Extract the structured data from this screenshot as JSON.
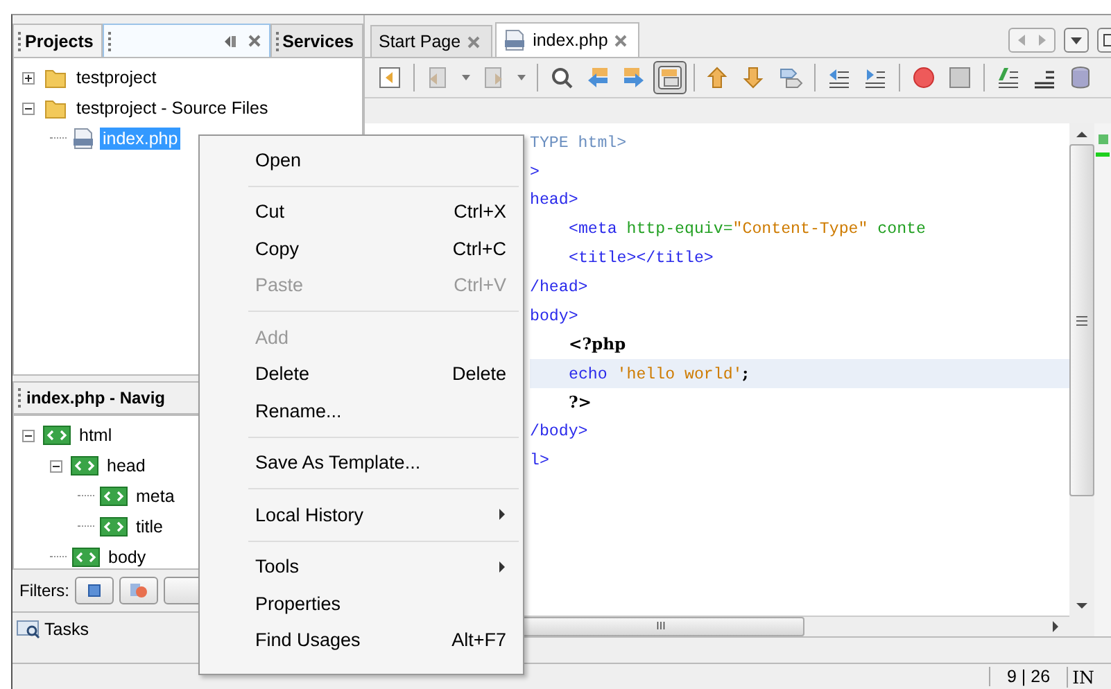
{
  "left_tabs": [
    {
      "label": "Projects",
      "selected": true
    },
    {
      "label": "Services",
      "selected": false
    }
  ],
  "project_tree": [
    {
      "label": "testproject",
      "kind": "folder",
      "expanded": false,
      "selected": false
    },
    {
      "label": "testproject - Source Files",
      "kind": "folder",
      "expanded": true,
      "selected": false,
      "children": [
        {
          "label": "index.php",
          "kind": "file",
          "selected": true
        }
      ]
    }
  ],
  "navigator": {
    "title": "index.php - Navig",
    "tree": [
      {
        "label": "html",
        "expanded": true,
        "selected": false,
        "children": [
          {
            "label": "head",
            "expanded": true,
            "selected": false,
            "children": [
              {
                "label": "meta",
                "selected": false
              },
              {
                "label": "title",
                "selected": false
              }
            ]
          },
          {
            "label": "body",
            "selected": false
          }
        ]
      }
    ],
    "filters_label": "Filters:"
  },
  "tasks": "Tasks",
  "editor_tabs": [
    {
      "label": "Start Page",
      "kind": "page",
      "selected": false
    },
    {
      "label": "index.php",
      "kind": "file",
      "selected": true
    }
  ],
  "code_lines": [
    {
      "current": false,
      "indent": false,
      "tokens": [
        {
          "text": "TYPE html>",
          "kind": "doctype"
        }
      ]
    },
    {
      "current": false,
      "indent": false,
      "tokens": [
        {
          "text": ">",
          "kind": "tag"
        }
      ]
    },
    {
      "current": false,
      "indent": false,
      "tokens": [
        {
          "text": "head>",
          "kind": "tag"
        }
      ]
    },
    {
      "current": false,
      "indent": true,
      "tokens": [
        {
          "text": "<meta",
          "kind": "tag"
        },
        {
          "text": " http-equiv=",
          "kind": "attr"
        },
        {
          "text": "\"Content-Type\"",
          "kind": "string"
        },
        {
          "text": " conte",
          "kind": "attr"
        }
      ]
    },
    {
      "current": false,
      "indent": true,
      "tokens": [
        {
          "text": "<title></title>",
          "kind": "tag"
        }
      ]
    },
    {
      "current": false,
      "indent": false,
      "tokens": [
        {
          "text": "/head>",
          "kind": "tag"
        }
      ]
    },
    {
      "current": false,
      "indent": false,
      "tokens": [
        {
          "text": "body>",
          "kind": "tag"
        }
      ]
    },
    {
      "current": false,
      "indent": true,
      "tokens": [
        {
          "text": "<?php",
          "kind": "php"
        }
      ]
    },
    {
      "current": true,
      "indent": true,
      "tokens": [
        {
          "text": "echo",
          "kind": "keyword"
        },
        {
          "text": " 'hello world'",
          "kind": "string"
        },
        {
          "text": ";",
          "kind": "php"
        }
      ]
    },
    {
      "current": false,
      "indent": true,
      "tokens": [
        {
          "text": "?>",
          "kind": "php"
        }
      ]
    },
    {
      "current": false,
      "indent": false,
      "tokens": [
        {
          "text": "/body>",
          "kind": "tag"
        }
      ]
    },
    {
      "current": false,
      "indent": false,
      "tokens": [
        {
          "text": "l>",
          "kind": "tag"
        }
      ]
    }
  ],
  "hscroll_grip": "III",
  "status_bar": {
    "position": "9 | 26",
    "mode": "IN"
  },
  "context_menu": [
    {
      "kind": "item",
      "label": "Open",
      "disabled": false,
      "submenu": false
    },
    {
      "kind": "separator"
    },
    {
      "kind": "item",
      "label": "Cut",
      "shortcut": "Ctrl+X",
      "disabled": false,
      "submenu": false
    },
    {
      "kind": "item",
      "label": "Copy",
      "shortcut": "Ctrl+C",
      "disabled": false,
      "submenu": false
    },
    {
      "kind": "item",
      "label": "Paste",
      "shortcut": "Ctrl+V",
      "disabled": true,
      "submenu": false
    },
    {
      "kind": "separator"
    },
    {
      "kind": "item",
      "label": "Add",
      "disabled": true,
      "submenu": false
    },
    {
      "kind": "item",
      "label": "Delete",
      "shortcut": "Delete",
      "disabled": false,
      "submenu": false
    },
    {
      "kind": "item",
      "label": "Rename...",
      "disabled": false,
      "submenu": false
    },
    {
      "kind": "separator"
    },
    {
      "kind": "item",
      "label": "Save As Template...",
      "disabled": false,
      "submenu": false
    },
    {
      "kind": "separator"
    },
    {
      "kind": "item",
      "label": "Local History",
      "disabled": false,
      "submenu": true
    },
    {
      "kind": "separator"
    },
    {
      "kind": "item",
      "label": "Tools",
      "disabled": false,
      "submenu": true
    },
    {
      "kind": "item",
      "label": "Properties",
      "disabled": false,
      "submenu": false
    },
    {
      "kind": "item",
      "label": "Find Usages",
      "shortcut": "Alt+F7",
      "disabled": false,
      "submenu": false
    }
  ]
}
